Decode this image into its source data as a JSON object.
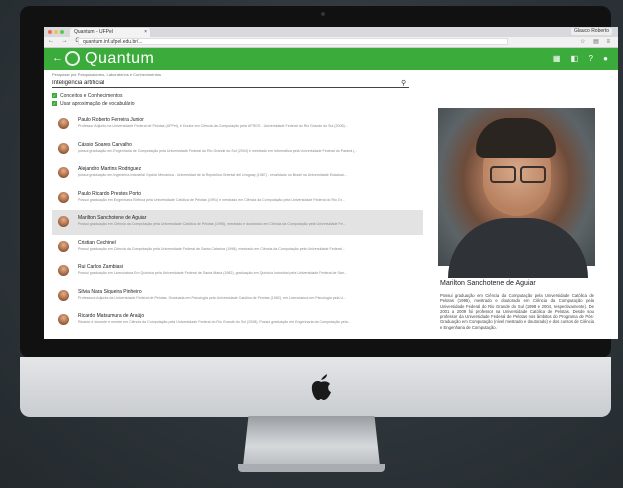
{
  "browser": {
    "tab_title": "Quantum - UFPel",
    "tab_close": "×",
    "user": "Glauco Roberto",
    "url": "quantum.inf.ufpel.edu.br/...",
    "nav": "← → C",
    "window_dots": [
      "#ec6a5e",
      "#f4bf4f",
      "#61c554"
    ]
  },
  "app": {
    "back": "←",
    "title": "Quantum",
    "accent": "#3bab3b",
    "icons": [
      "▦",
      "◧",
      "?",
      "●"
    ]
  },
  "search": {
    "label": "Pesquisar por Pesquisadores, Laboratórios e Conhecimentos",
    "value": "Inteligência artificial",
    "icon": "⚲"
  },
  "options": [
    {
      "label": "Conceitos e Conhecimentos",
      "checked": true
    },
    {
      "label": "Usar aproximação de vocabulário",
      "checked": true
    }
  ],
  "results": [
    {
      "name": "Paulo Roberto Ferreira Junior",
      "desc": "Professor Adjunto na Universidade Federal de Pelotas (UFPel), é Doutor em Ciência da Computação pela UFRGS - Universidade Federal do Rio Grande do Sul (2008)..."
    },
    {
      "name": "Cássio Soares Carvalho",
      "desc": "possui graduação em Engenharia de Computação pela Universidade Federal do Rio Grande do Sul (2004) e mestrado em Informática pela Universidade Federal do Paraná (..."
    },
    {
      "name": "Alejandro Martins Rodriguez",
      "desc": "possui graduação em Ingeniería Industrial Opción Mecánica - Universidad de la República Oriental del Uruguay (1987) - revalidado no Brasil na Universidade Estadual..."
    },
    {
      "name": "Paulo Ricardo Prestes Porto",
      "desc": "Possui graduação em Engenharia Elétrica pela Universidade Católica de Pelotas (1991) e mestrado em Ciência da Computação pela Universidade Federal do Rio Gr..."
    },
    {
      "name": "Marilton Sanchotene de Aguiar",
      "desc": "Possui graduação em Ciência da Computação pela Universidade Católica de Pelotas (1995), mestrado e doutorado em Ciência da Computação pela Universidade Fe...",
      "selected": true
    },
    {
      "name": "Cristian Cechinel",
      "desc": "Possui graduação em Ciência da Computação pela Universidade Federal de Santa Catarina (1998), mestrado em Ciência da Computação pela Universidade Federal..."
    },
    {
      "name": "Rui Carlos Zambiasi",
      "desc": "Possui graduação em Licenciatura Em Química pela Universidade Federal de Santa Maria (1982), graduação em Química Industrial pela Universidade Federal de San..."
    },
    {
      "name": "Silvia Nara Siqueira Pinheiro",
      "desc": "Professora Adjunta da Universidade Federal de Pelotas. Graduada em Psicologia pela Universidade Católica de Pelotas (1982), em Licenciatura em Psicologia pela U..."
    },
    {
      "name": "Ricardo Matsumura de Araújo",
      "desc": "Ricardo é docente e mestre em Ciência da Computação pela Universidade Federal do Rio Grande do Sul (2008). Possui graduação em Engenharia da Computação pela..."
    }
  ],
  "detail": {
    "name": "Marilton Sanchotene de Aguiar",
    "bio": "Possui graduação em Ciência da Computação pela Universidade Católica de Pelotas (1995), mestrado e doutorado em Ciência da Computação pela Universidade Federal do Rio Grande do Sul (1998 e 2004, respectivamente). De 2001 a 2009 foi professor na Universidade Católica de Pelotas. Desde sou professor da Universidade Federal de Pelotas nos âmbitos do Programa de Pós-Graduação em Computação (nível mestrado e doutorado) e dos cursos de Ciência e Engenharia de Computação."
  }
}
